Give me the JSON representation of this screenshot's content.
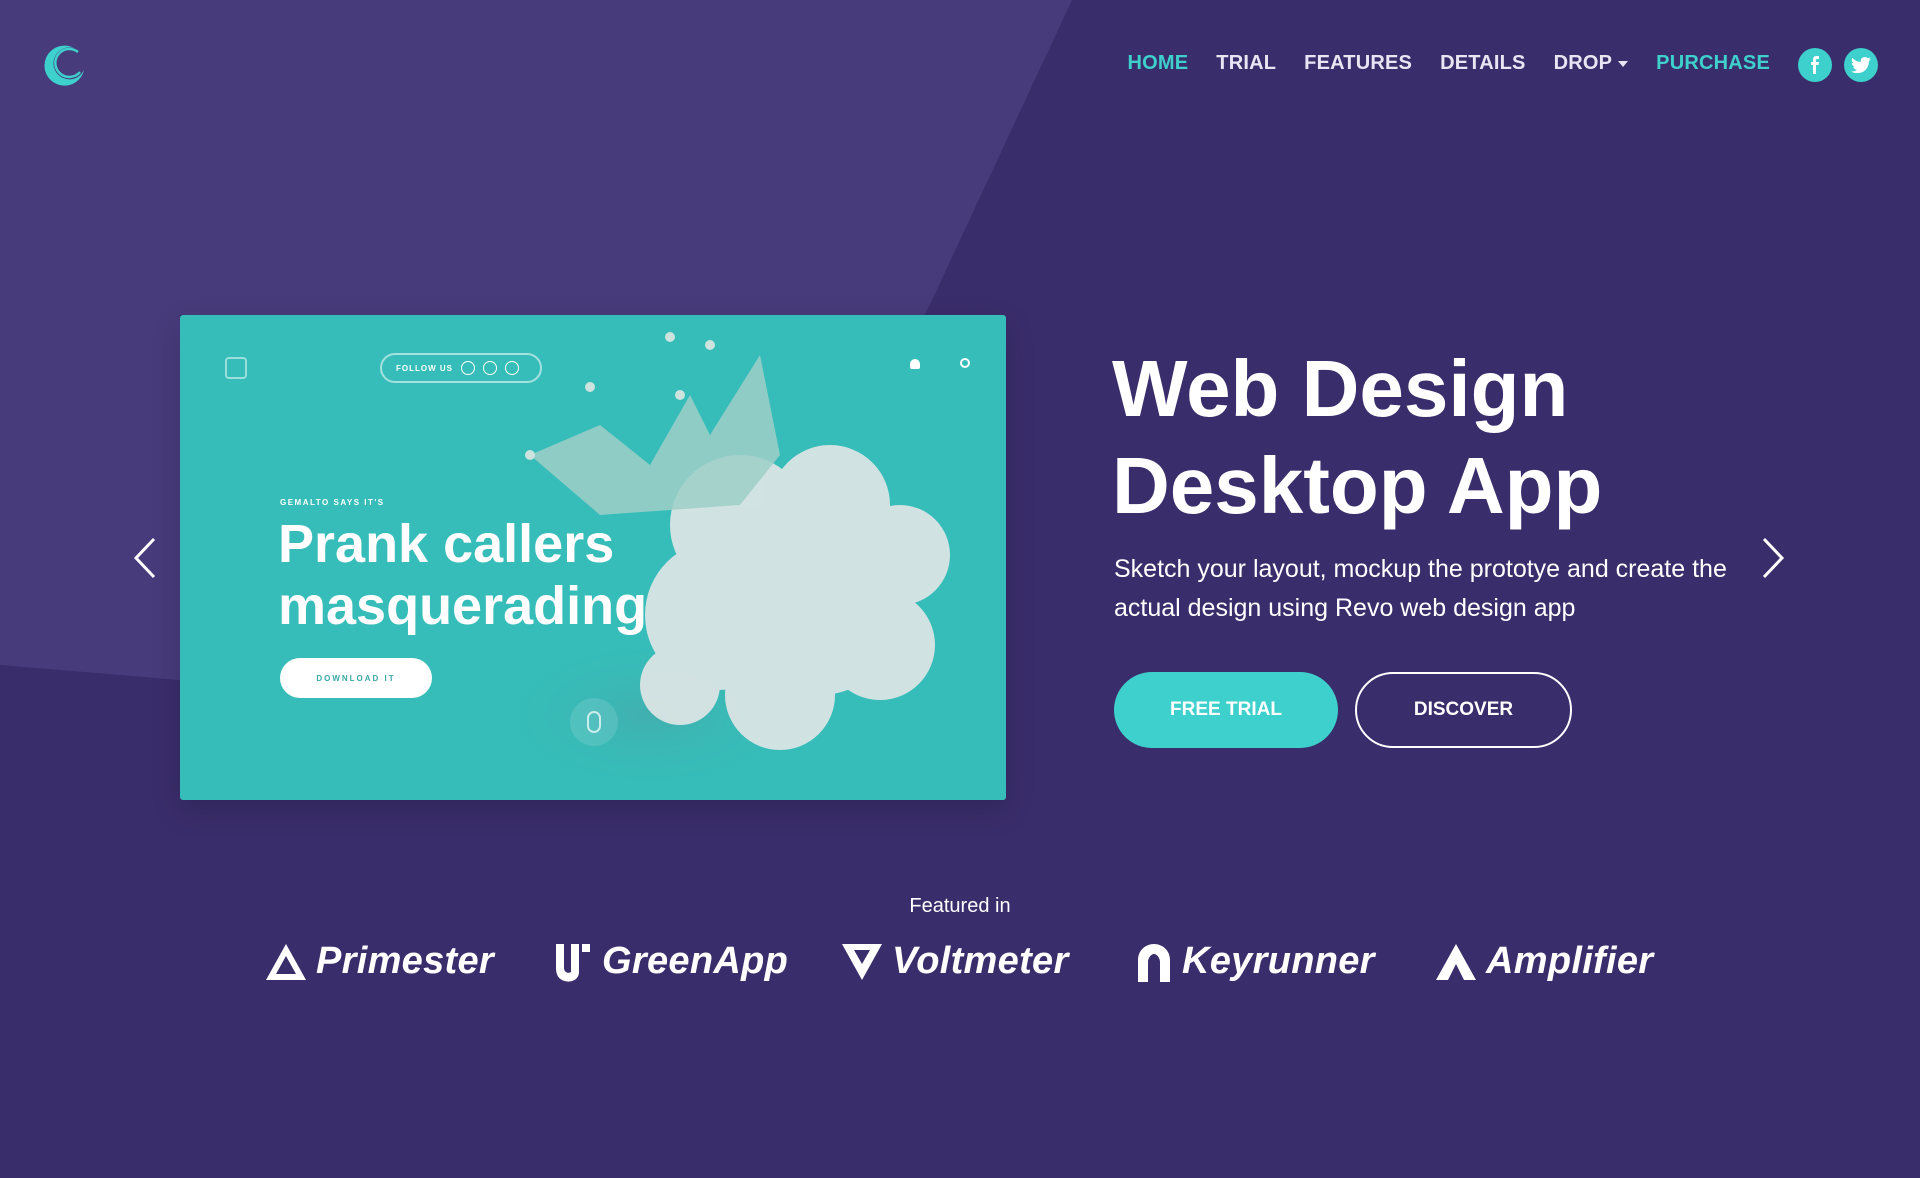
{
  "colors": {
    "background": "#3a2d6b",
    "accent": "#3ed0cc",
    "mockup": "#36bdb9"
  },
  "header": {
    "logo_icon": "crescent-logo-icon",
    "nav": [
      {
        "label": "HOME",
        "state": "active"
      },
      {
        "label": "TRIAL"
      },
      {
        "label": "FEATURES"
      },
      {
        "label": "DETAILS"
      },
      {
        "label": "DROP",
        "has_dropdown": true
      },
      {
        "label": "PURCHASE",
        "state": "accent"
      }
    ],
    "social": [
      "facebook-icon",
      "twitter-icon"
    ]
  },
  "slider": {
    "prev_icon": "chevron-left-icon",
    "next_icon": "chevron-right-icon",
    "mockup": {
      "follow_label": "FOLLOW US",
      "kicker": "GEMALTO SAYS IT'S",
      "title": "Prank callers masquerading",
      "button": "DOWNLOAD IT"
    }
  },
  "hero": {
    "title": "Web Design Desktop App",
    "subtitle": "Sketch your layout, mockup the prototye and create the actual design using Revo web design app",
    "primary_button": "FREE TRIAL",
    "secondary_button": "DISCOVER"
  },
  "featured": {
    "label": "Featured in",
    "brands": [
      "Primester",
      "GreenApp",
      "Voltmeter",
      "Keyrunner",
      "Amplifier"
    ]
  }
}
